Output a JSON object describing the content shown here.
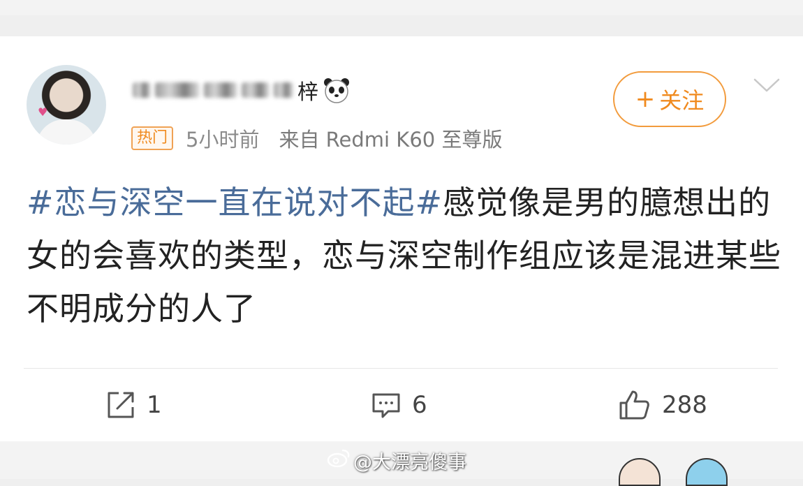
{
  "header": {
    "username_visible_char": "梓",
    "verification_emoji": "panda-face-icon"
  },
  "meta": {
    "hot_badge": "热门",
    "time": "5小时前",
    "source": "来自 Redmi K60 至尊版"
  },
  "follow_button": {
    "plus": "+",
    "label": "关注"
  },
  "post": {
    "topic": "#恋与深空一直在说对不起#",
    "body": "感觉像是男的臆想出的女的会喜欢的类型，恋与深空制作组应该是混进某些不明成分的人了"
  },
  "actions": {
    "repost_count": "1",
    "comment_count": "6",
    "like_count": "288"
  },
  "watermark": {
    "text": "@大漂亮傻事"
  },
  "colors": {
    "accent_orange": "#f08a1e",
    "topic_blue": "#4a6c99",
    "text_dark": "#222222",
    "meta_gray": "#8b8b8b"
  }
}
